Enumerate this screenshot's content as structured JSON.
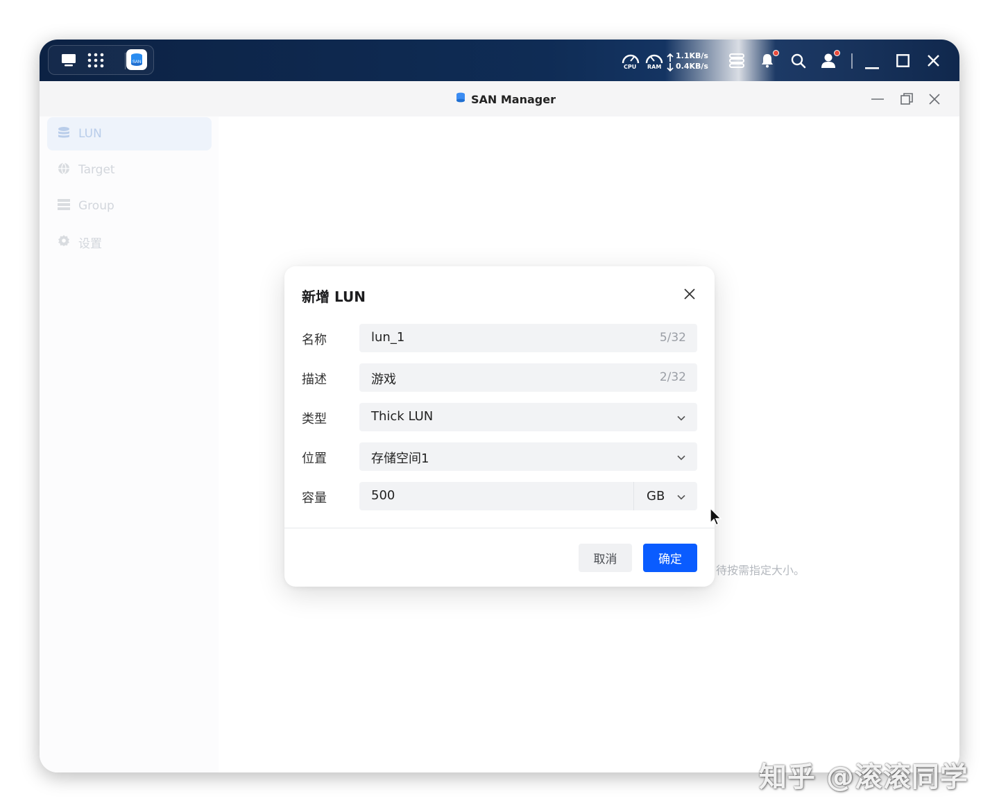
{
  "taskbar": {
    "icons": [
      "desktop-icon",
      "apps-grid-icon",
      "san-manager-app-icon"
    ],
    "cpu_label": "CPU",
    "ram_label": "RAM",
    "upload_speed": "1.1KB/s",
    "download_speed": "0.4KB/s",
    "right_icons": [
      "task-list-icon",
      "bell-icon",
      "search-icon",
      "user-icon",
      "minimize-icon",
      "maximize-icon",
      "close-icon"
    ]
  },
  "window": {
    "title": "SAN Manager",
    "controls": [
      "minimize-icon",
      "restore-icon",
      "close-icon"
    ]
  },
  "sidebar": {
    "items": [
      {
        "label": "LUN",
        "icon": "database-icon",
        "active": true
      },
      {
        "label": "Target",
        "icon": "globe-icon",
        "active": false
      },
      {
        "label": "Group",
        "icon": "list-icon",
        "active": false
      },
      {
        "label": "设置",
        "icon": "gear-icon",
        "active": false
      }
    ]
  },
  "content": {
    "hint_text": "待按需指定大小。"
  },
  "dialog": {
    "title": "新增 LUN",
    "fields": {
      "name": {
        "label": "名称",
        "value": "lun_1",
        "count": "5/32"
      },
      "description": {
        "label": "描述",
        "value": "游戏",
        "count": "2/32"
      },
      "type": {
        "label": "类型",
        "value": "Thick LUN"
      },
      "location": {
        "label": "位置",
        "value": "存储空间1"
      },
      "capacity": {
        "label": "容量",
        "value": "500",
        "unit": "GB"
      }
    },
    "cancel_label": "取消",
    "ok_label": "确定"
  },
  "watermark": "知乎 @滚滚同学",
  "colors": {
    "accent": "#0a5cff",
    "taskbar": "#0f2c55",
    "notification_dot": "#e94b3c"
  }
}
